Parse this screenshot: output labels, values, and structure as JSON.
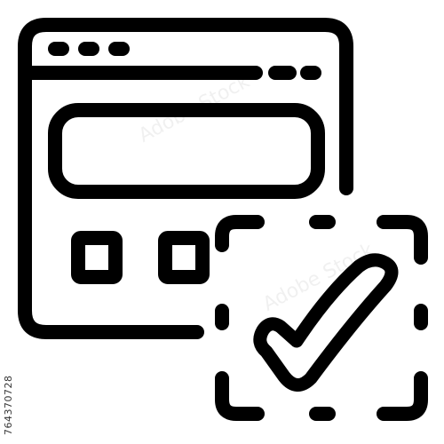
{
  "image_id_text": "764370728",
  "watermark_text": "Adobe Stock",
  "colors": {
    "stroke": "#000000",
    "background": "#ffffff"
  },
  "icons": {
    "main": "web-approval-icon",
    "window": "browser-window-icon",
    "check": "checkmark-icon"
  }
}
